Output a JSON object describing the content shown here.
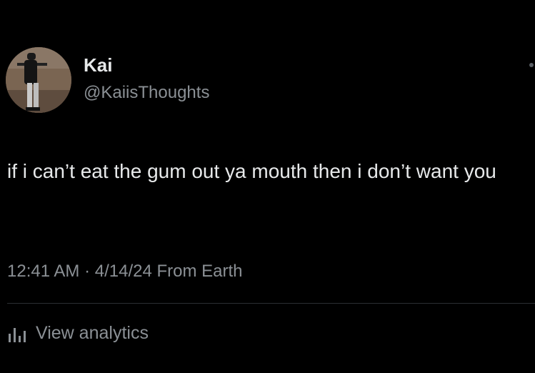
{
  "author": {
    "display_name": "Kai",
    "handle": "@KaiisThoughts",
    "avatar_icon": "person-photo-avatar"
  },
  "tweet": {
    "text": "if i can’t eat the gum out ya mouth then i don’t want you",
    "meta": "12:41 AM · 4/14/24 From Earth"
  },
  "actions": {
    "analytics_label": "View analytics",
    "analytics_icon": "bar-chart-icon"
  },
  "colors": {
    "background": "#000000",
    "primary_text": "#e7e9ea",
    "secondary_text": "#8b9095",
    "divider": "#2b2f33"
  }
}
